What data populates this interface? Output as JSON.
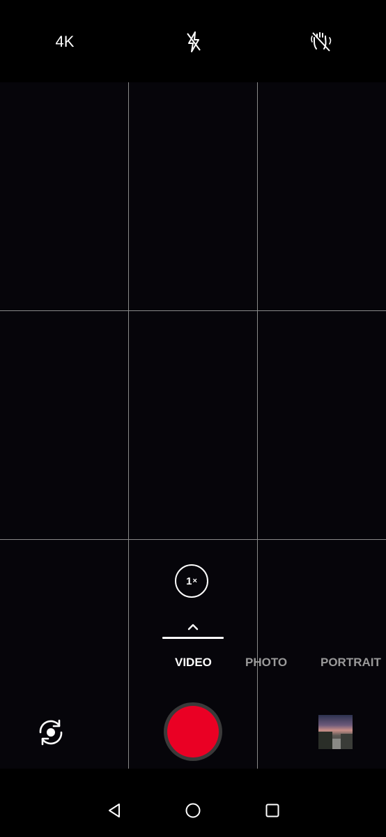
{
  "top_bar": {
    "resolution_label": "4K",
    "flash_icon": "flash-off-icon",
    "stabilization_icon": "hand-stabilization-off-icon"
  },
  "viewfinder": {
    "grid": "3x3"
  },
  "zoom": {
    "value": "1",
    "suffix": "×"
  },
  "modes": {
    "items": [
      "VIDEO",
      "PHOTO",
      "PORTRAIT"
    ],
    "selected": "VIDEO"
  },
  "controls": {
    "switch_camera_icon": "switch-camera-icon",
    "record_icon": "record-button",
    "gallery_icon": "gallery-thumbnail"
  },
  "navigation": {
    "back_icon": "back-triangle-icon",
    "home_icon": "home-circle-icon",
    "recents_icon": "recents-square-icon"
  },
  "colors": {
    "record": "#ea0024",
    "selected_mode": "#ffffff",
    "unselected_mode": "#9a9a9a",
    "background": "#000000"
  }
}
